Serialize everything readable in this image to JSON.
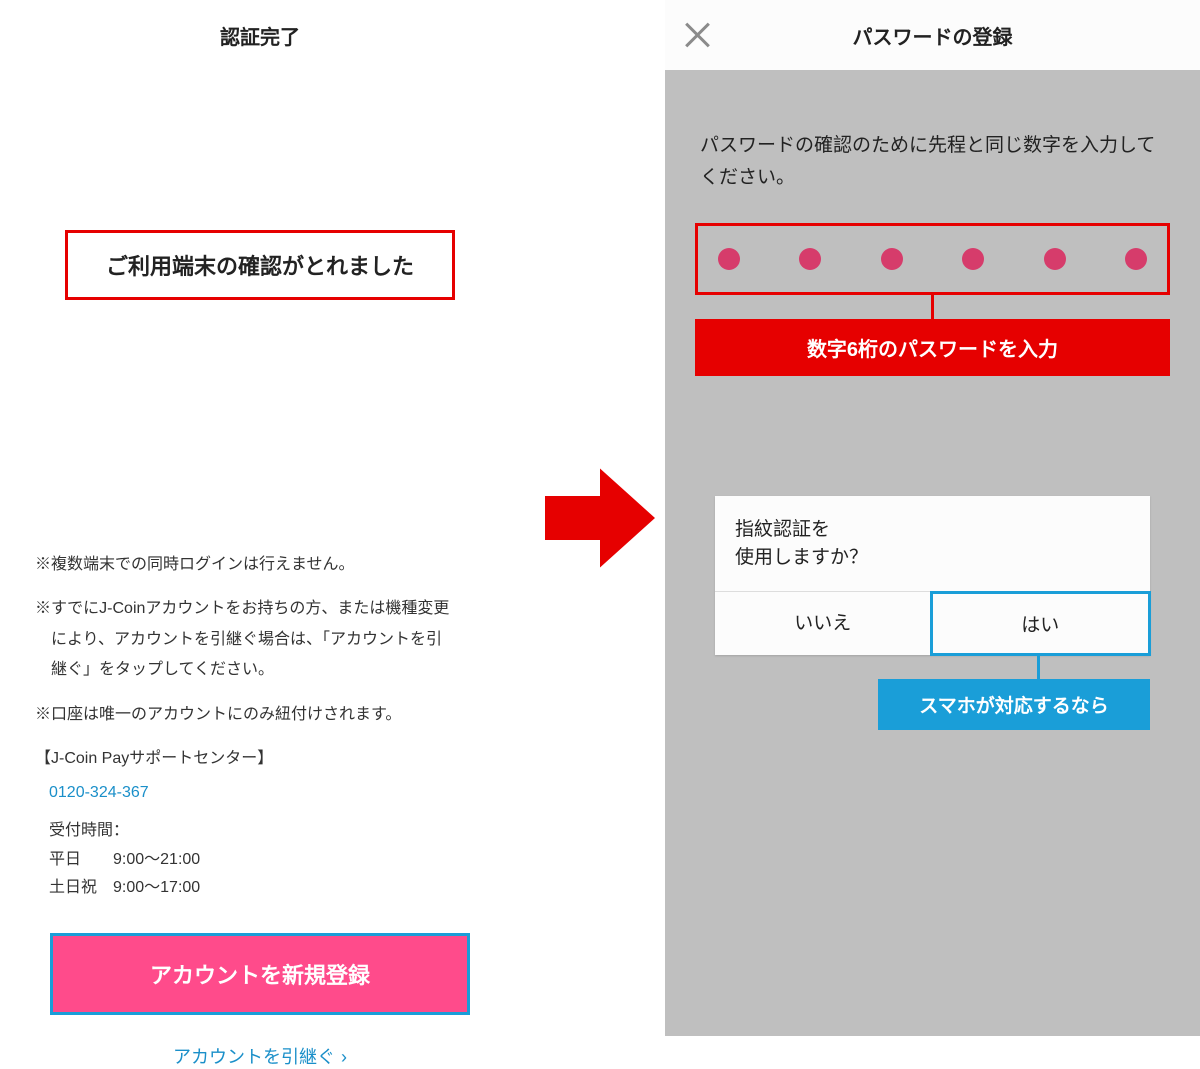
{
  "left": {
    "header": "認証完了",
    "confirm_message": "ご利用端末の確認がとれました",
    "note1": "※複数端末での同時ログインは行えません。",
    "note2": "※すでにJ-Coinアカウントをお持ちの方、または機種変更",
    "note2b": "により、アカウントを引継ぐ場合は、「アカウントを引",
    "note2c": "継ぐ」をタップしてください。",
    "note3": "※口座は唯一のアカウントにのみ紐付けされます。",
    "support_label": "【J-Coin Payサポートセンター】",
    "phone": "0120-324-367",
    "hours_label": "受付時間：",
    "hours_weekday": "平日　　9:00〜21:00",
    "hours_weekend": "土日祝　9:00〜17:00",
    "primary_button": "アカウントを新規登録",
    "inherit_link": "アカウントを引継ぐ",
    "chevron": "›"
  },
  "right": {
    "header": "パスワードの登録",
    "instruction": "パスワードの確認のために先程と同じ数字を入力してください。",
    "callout_red": "数字6桁のパスワードを入力",
    "dialog_line1": "指紋認証を",
    "dialog_line2": "使用しますか？",
    "dialog_no": "いいえ",
    "dialog_yes": "はい",
    "callout_blue": "スマホが対応するなら"
  },
  "colors": {
    "red": "#e60000",
    "pink": "#ff4b8b",
    "blue": "#1a9ed8",
    "dot": "#d63c6b"
  }
}
